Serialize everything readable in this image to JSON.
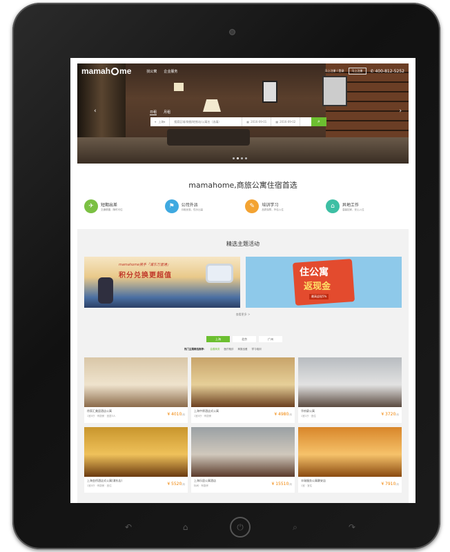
{
  "header": {
    "logo": "mamahome",
    "nav": [
      "找公寓",
      "企业服务"
    ],
    "user_links": "马上注册 / 登录",
    "login_box": "马上注册",
    "phone": "400-812-5252"
  },
  "hero": {
    "tabs": [
      "日租",
      "月租"
    ],
    "search": {
      "city": "上海",
      "keyword_placeholder": "搜索区域/商圈/地铁站/公寓名（选填）",
      "checkin": "2016-09-01",
      "checkout": "2016-09-02"
    }
  },
  "headline": "mamahome,商旅公寓住宿首选",
  "features": [
    {
      "title": "短期出差",
      "sub": "交通便捷，随时可住",
      "color": "#7bc043",
      "icon": "briefcase-icon"
    },
    {
      "title": "公司外派",
      "sub": "月租优惠，性价比高",
      "color": "#3fa9e0",
      "icon": "plane-icon"
    },
    {
      "title": "培训学习",
      "sub": "品质保障，拎包入住",
      "color": "#f3a332",
      "icon": "book-icon"
    },
    {
      "title": "异地工作",
      "sub": "温馨如家，安心入住",
      "color": "#3dbfa4",
      "icon": "building-icon"
    }
  ],
  "themes": {
    "title": "精选主题活动",
    "banner1": {
      "line1": "mamahome携手「浦东万里通」",
      "line2": "积分兑换更超值"
    },
    "banner2": {
      "line1": "住公寓",
      "line2": "返现金",
      "line3": "最高返现5%"
    },
    "more": "查看更多 >"
  },
  "category_tabs": [
    "上海",
    "北京",
    "广州"
  ],
  "filters": {
    "label": "热门主题精选推荐：",
    "items": [
      "会展商务",
      "医疗就诊",
      "商旅出差",
      "学习培训"
    ]
  },
  "listings": [
    {
      "name": "徐家汇美居酒店公寓",
      "meta": "1室0厅 · 有厨房 · 宜居3人",
      "price": "¥ 4010",
      "unit": "/月",
      "colors": [
        "#d9c7a8",
        "#efe3cd",
        "#8a6a4a"
      ]
    },
    {
      "name": "上海中原酒店式公寓",
      "meta": "1室0厅 · 有厨房",
      "price": "¥ 4980",
      "unit": "/月",
      "colors": [
        "#c8a46a",
        "#e6cf98",
        "#6a3f1f"
      ]
    },
    {
      "name": "华府豪公寓",
      "meta": "1室1厅 · 宜住",
      "price": "¥ 3720",
      "unit": "/月",
      "colors": [
        "#b8bcc0",
        "#e2e2e2",
        "#5a4a40"
      ]
    },
    {
      "name": "上海金桥酒店式公寓(浦东店)",
      "meta": "1室0厅 · 有厨房 · 宜住",
      "price": "¥ 5520",
      "unit": "/月",
      "colors": [
        "#c9962d",
        "#efc15a",
        "#6a3a10"
      ]
    },
    {
      "name": "上海乐居公寓酒店",
      "meta": "标间 · 有厨房",
      "price": "¥ 15510",
      "unit": "/月",
      "colors": [
        "#9aa0a4",
        "#d0c8bc",
        "#5a3a2a"
      ]
    },
    {
      "name": "丰瑞服务公寓静安店",
      "meta": "1室 · 宜住",
      "price": "¥ 7910",
      "unit": "/月",
      "colors": [
        "#d8862a",
        "#f6c26a",
        "#8a4a10"
      ]
    }
  ]
}
